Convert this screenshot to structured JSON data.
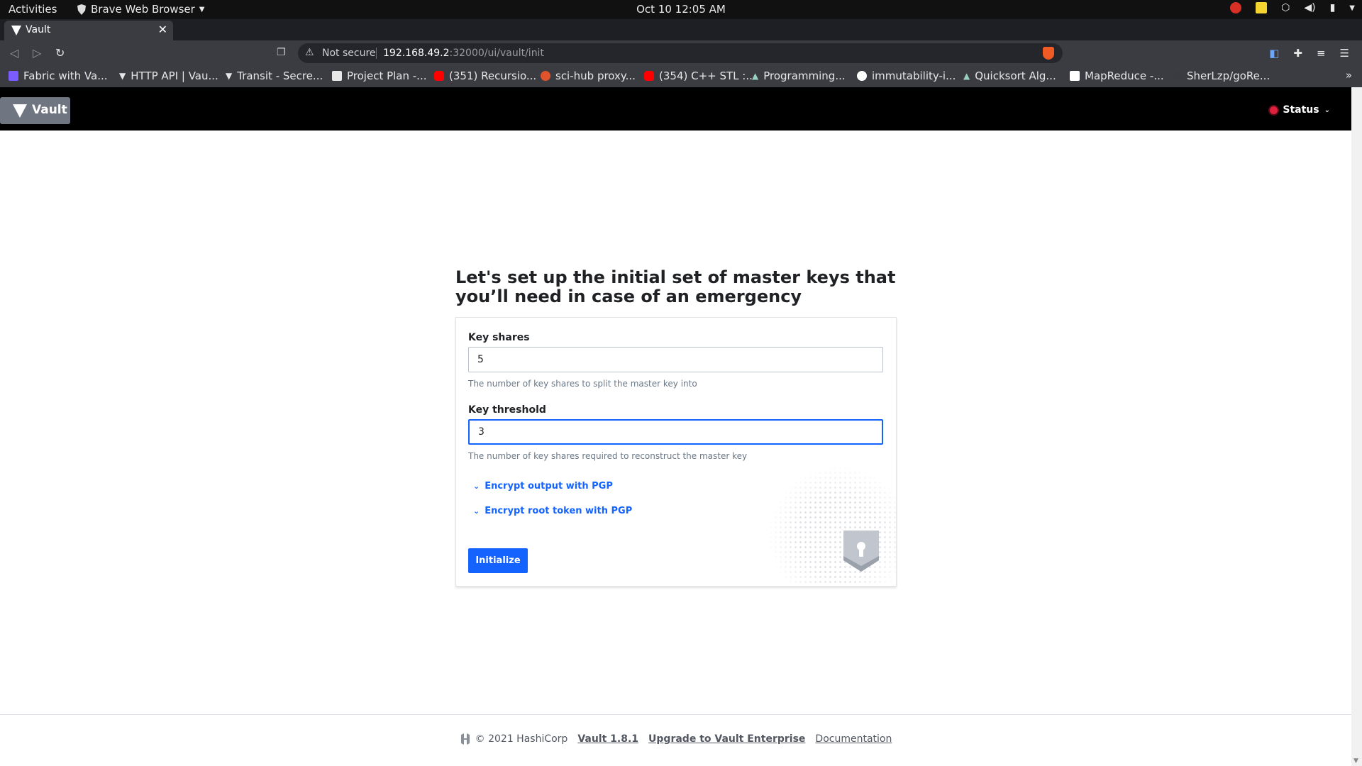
{
  "os": {
    "activities": "Activities",
    "app_menu": "Brave Web Browser",
    "clock": "Oct 10  12:05 AM"
  },
  "browser": {
    "tab_title": "Vault",
    "url_warning": "Not secure",
    "url_host": "192.168.49.2",
    "url_rest": ":32000/ui/vault/init",
    "bookmarks": [
      {
        "label": "Fabric with Va...",
        "color": "#7b5cff"
      },
      {
        "label": "HTTP API | Vau...",
        "color": "#ffffff"
      },
      {
        "label": "Transit - Secre...",
        "color": "#ffffff"
      },
      {
        "label": "Project Plan -...",
        "color": "#e8e8e8"
      },
      {
        "label": "(351) Recursio...",
        "color": "#ff0000"
      },
      {
        "label": "sci-hub proxy...",
        "color": "#e0532b"
      },
      {
        "label": "(354) C++ STL :...",
        "color": "#ff0000"
      },
      {
        "label": "Programming...",
        "color": "#9ad0c0"
      },
      {
        "label": "immutability-i...",
        "color": "#ffffff"
      },
      {
        "label": "Quicksort Alg...",
        "color": "#9ad0c0"
      },
      {
        "label": "MapReduce -...",
        "color": "#ffffff"
      },
      {
        "label": "SherLzp/goRe...",
        "color": "#3a3b40"
      }
    ]
  },
  "vault": {
    "logo_label": "Vault",
    "status_label": "Status",
    "heading": "Let's set up the initial set of master keys that you’ll need in case of an emergency",
    "key_shares": {
      "label": "Key shares",
      "value": "5",
      "help": "The number of key shares to split the master key into"
    },
    "key_threshold": {
      "label": "Key threshold",
      "value": "3",
      "help": "The number of key shares required to reconstruct the master key"
    },
    "toggle_output_pgp": "Encrypt output with PGP",
    "toggle_root_pgp": "Encrypt root token with PGP",
    "initialize_label": "Initialize",
    "footer": {
      "copyright": "© 2021 HashiCorp",
      "version": "Vault 1.8.1",
      "upgrade": "Upgrade to Vault Enterprise",
      "docs": "Documentation"
    },
    "accent_color": "#1563ff"
  }
}
